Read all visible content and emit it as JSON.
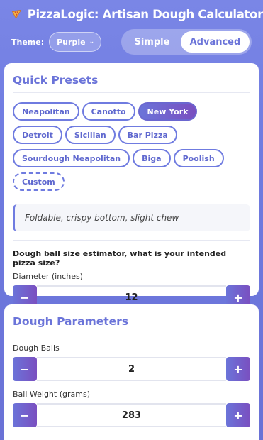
{
  "header": {
    "logo_icon": "pizza-slice-icon",
    "title": "PizzaLogic: Artisan Dough Calculator"
  },
  "theme": {
    "label": "Theme:",
    "selected": "Purple"
  },
  "mode": {
    "options": [
      "Simple",
      "Advanced"
    ],
    "active": "Advanced"
  },
  "presets_card": {
    "title": "Quick Presets",
    "chips": [
      "Neapolitan",
      "Canotto",
      "New York",
      "Detroit",
      "Sicilian",
      "Bar Pizza",
      "Sourdough Neapolitan",
      "Biga",
      "Poolish",
      "Custom"
    ],
    "active_chip": "New York",
    "description": "Foldable, crispy bottom, slight chew",
    "estimator_question": "Dough ball size estimator, what is your intended pizza size?",
    "diameter_label": "Diameter (inches)",
    "diameter_value": "12"
  },
  "dough_card": {
    "title": "Dough Parameters",
    "balls_label": "Dough Balls",
    "balls_value": "2",
    "weight_label": "Ball Weight (grams)",
    "weight_value": "283"
  },
  "stepper": {
    "minus": "−",
    "plus": "+"
  },
  "colors": {
    "accent": "#6b74d9",
    "accent_dark": "#7a4fc0",
    "background": "#7a86e6"
  }
}
